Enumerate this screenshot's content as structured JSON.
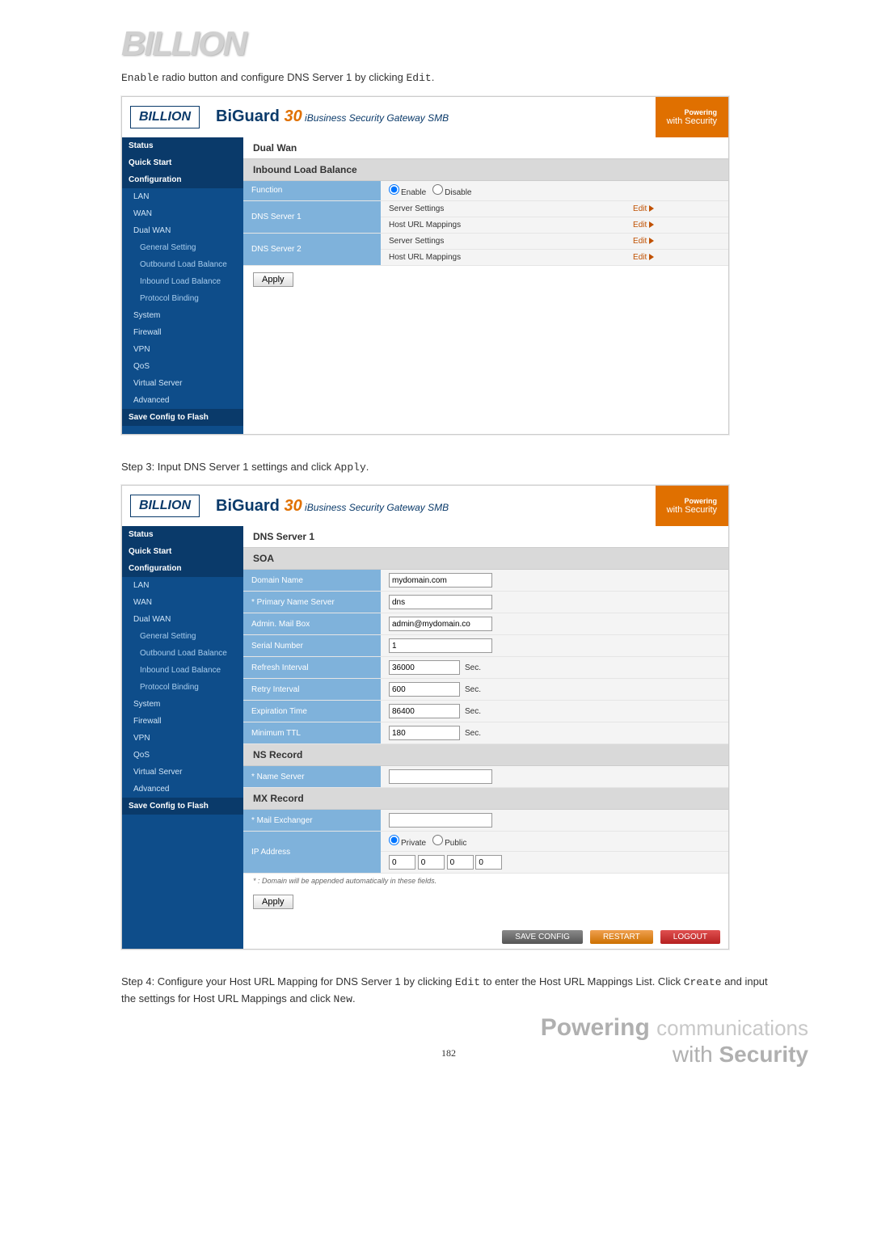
{
  "top_logo": "BILLION",
  "step1_pre": "Enable",
  "step1_mid": " radio button and configure DNS Server 1 by clicking ",
  "step1_post": "Edit",
  "step1_end": ".",
  "step2": "Step 3: Input DNS Server 1 settings and click ",
  "step2_apply": "Apply",
  "step2_end": ".",
  "step3_1": "Step 4: Configure your Host URL Mapping for DNS Server 1 by clicking ",
  "step3_edit": "Edit",
  "step3_2": " to enter the Host URL Mappings List. Click ",
  "step3_create": "Create",
  "step3_3": " and input the settings for Host URL Mappings and click ",
  "step3_new": "New",
  "step3_end": ".",
  "page_number": "182",
  "ui": {
    "logo": "BILLION",
    "biguard_prefix": "BiGuard ",
    "biguard_num": "30",
    "biguard_sub": " iBusiness Security Gateway SMB",
    "powering": "Powering",
    "with_sec": "with Security",
    "sidebar": [
      {
        "label": "Status",
        "lvl": 0
      },
      {
        "label": "Quick Start",
        "lvl": 0
      },
      {
        "label": "Configuration",
        "lvl": 0
      },
      {
        "label": "LAN",
        "lvl": 1
      },
      {
        "label": "WAN",
        "lvl": 1
      },
      {
        "label": "Dual WAN",
        "lvl": 1
      },
      {
        "label": "General Setting",
        "lvl": 2
      },
      {
        "label": "Outbound Load Balance",
        "lvl": 2
      },
      {
        "label": "Inbound Load Balance",
        "lvl": 2
      },
      {
        "label": "Protocol Binding",
        "lvl": 2
      },
      {
        "label": "System",
        "lvl": 1
      },
      {
        "label": "Firewall",
        "lvl": 1
      },
      {
        "label": "VPN",
        "lvl": 1
      },
      {
        "label": "QoS",
        "lvl": 1
      },
      {
        "label": "Virtual Server",
        "lvl": 1
      },
      {
        "label": "Advanced",
        "lvl": 1
      },
      {
        "label": "Save Config to Flash",
        "lvl": 0
      }
    ],
    "apply": "Apply"
  },
  "screen1": {
    "title": "Dual Wan",
    "section": "Inbound Load Balance",
    "rows": {
      "function_label": "Function",
      "enable": "Enable",
      "disable": "Disable",
      "dns1_label": "DNS Server 1",
      "dns2_label": "DNS Server 2",
      "server_settings": "Server Settings",
      "host_url": "Host URL Mappings",
      "edit": "Edit"
    }
  },
  "screen2": {
    "title": "DNS Server 1",
    "soa": "SOA",
    "domain_name_label": "Domain Name",
    "domain_name": "mydomain.com",
    "primary_ns_label": "* Primary Name Server",
    "primary_ns": "dns",
    "admin_mail_label": "Admin. Mail Box",
    "admin_mail": "admin@mydomain.co",
    "serial_label": "Serial Number",
    "serial": "1",
    "refresh_label": "Refresh Interval",
    "refresh": "36000",
    "retry_label": "Retry Interval",
    "retry": "600",
    "exp_label": "Expiration Time",
    "exp": "86400",
    "minttl_label": "Minimum TTL",
    "minttl": "180",
    "sec": "Sec.",
    "ns_record": "NS Record",
    "ns_label": "* Name Server",
    "ns_val": "",
    "mx_record": "MX Record",
    "mx_label": "* Mail Exchanger",
    "mx_val": "",
    "ip_label": "IP Address",
    "private": "Private",
    "public": "Public",
    "ip": [
      "0",
      "0",
      "0",
      "0"
    ],
    "footnote": "* : Domain will be appended automatically in these fields.",
    "save_config": "SAVE CONFIG",
    "restart": "RESTART",
    "logout": "LOGOUT"
  }
}
